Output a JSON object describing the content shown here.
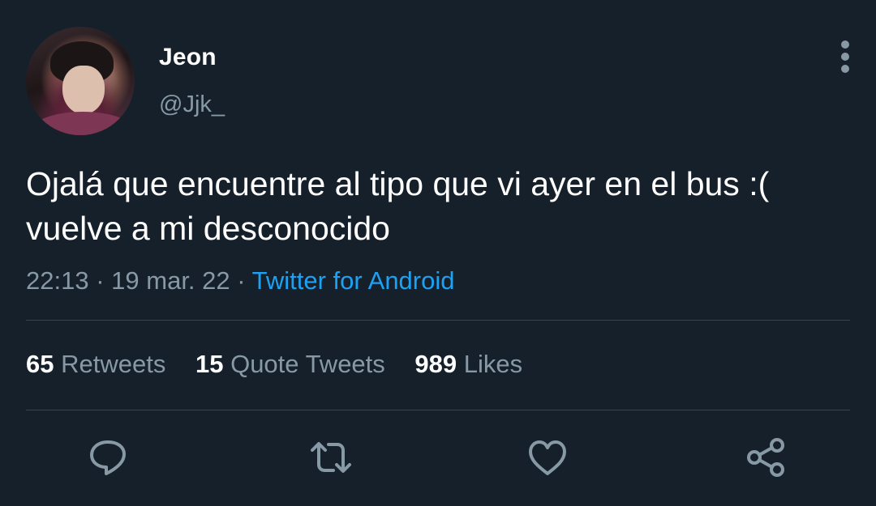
{
  "author": {
    "display_name": "Jeon",
    "handle": "@Jjk_"
  },
  "tweet": {
    "text": "Ojalá que encuentre al tipo que vi ayer en el bus :( vuelve a mi desconocido",
    "time": "22:13",
    "separator": "·",
    "date": "19 mar. 22",
    "source": "Twitter for Android"
  },
  "stats": {
    "retweets_count": "65",
    "retweets_label": "Retweets",
    "quotes_count": "15",
    "quotes_label": "Quote Tweets",
    "likes_count": "989",
    "likes_label": "Likes"
  },
  "actions": {
    "icons": [
      "reply-icon",
      "retweet-icon",
      "like-icon",
      "share-icon"
    ]
  },
  "colors": {
    "background": "#15202b",
    "primary_text": "#ffffff",
    "secondary_text": "#8899a6",
    "link": "#1da1f2",
    "divider": "#38444d"
  }
}
